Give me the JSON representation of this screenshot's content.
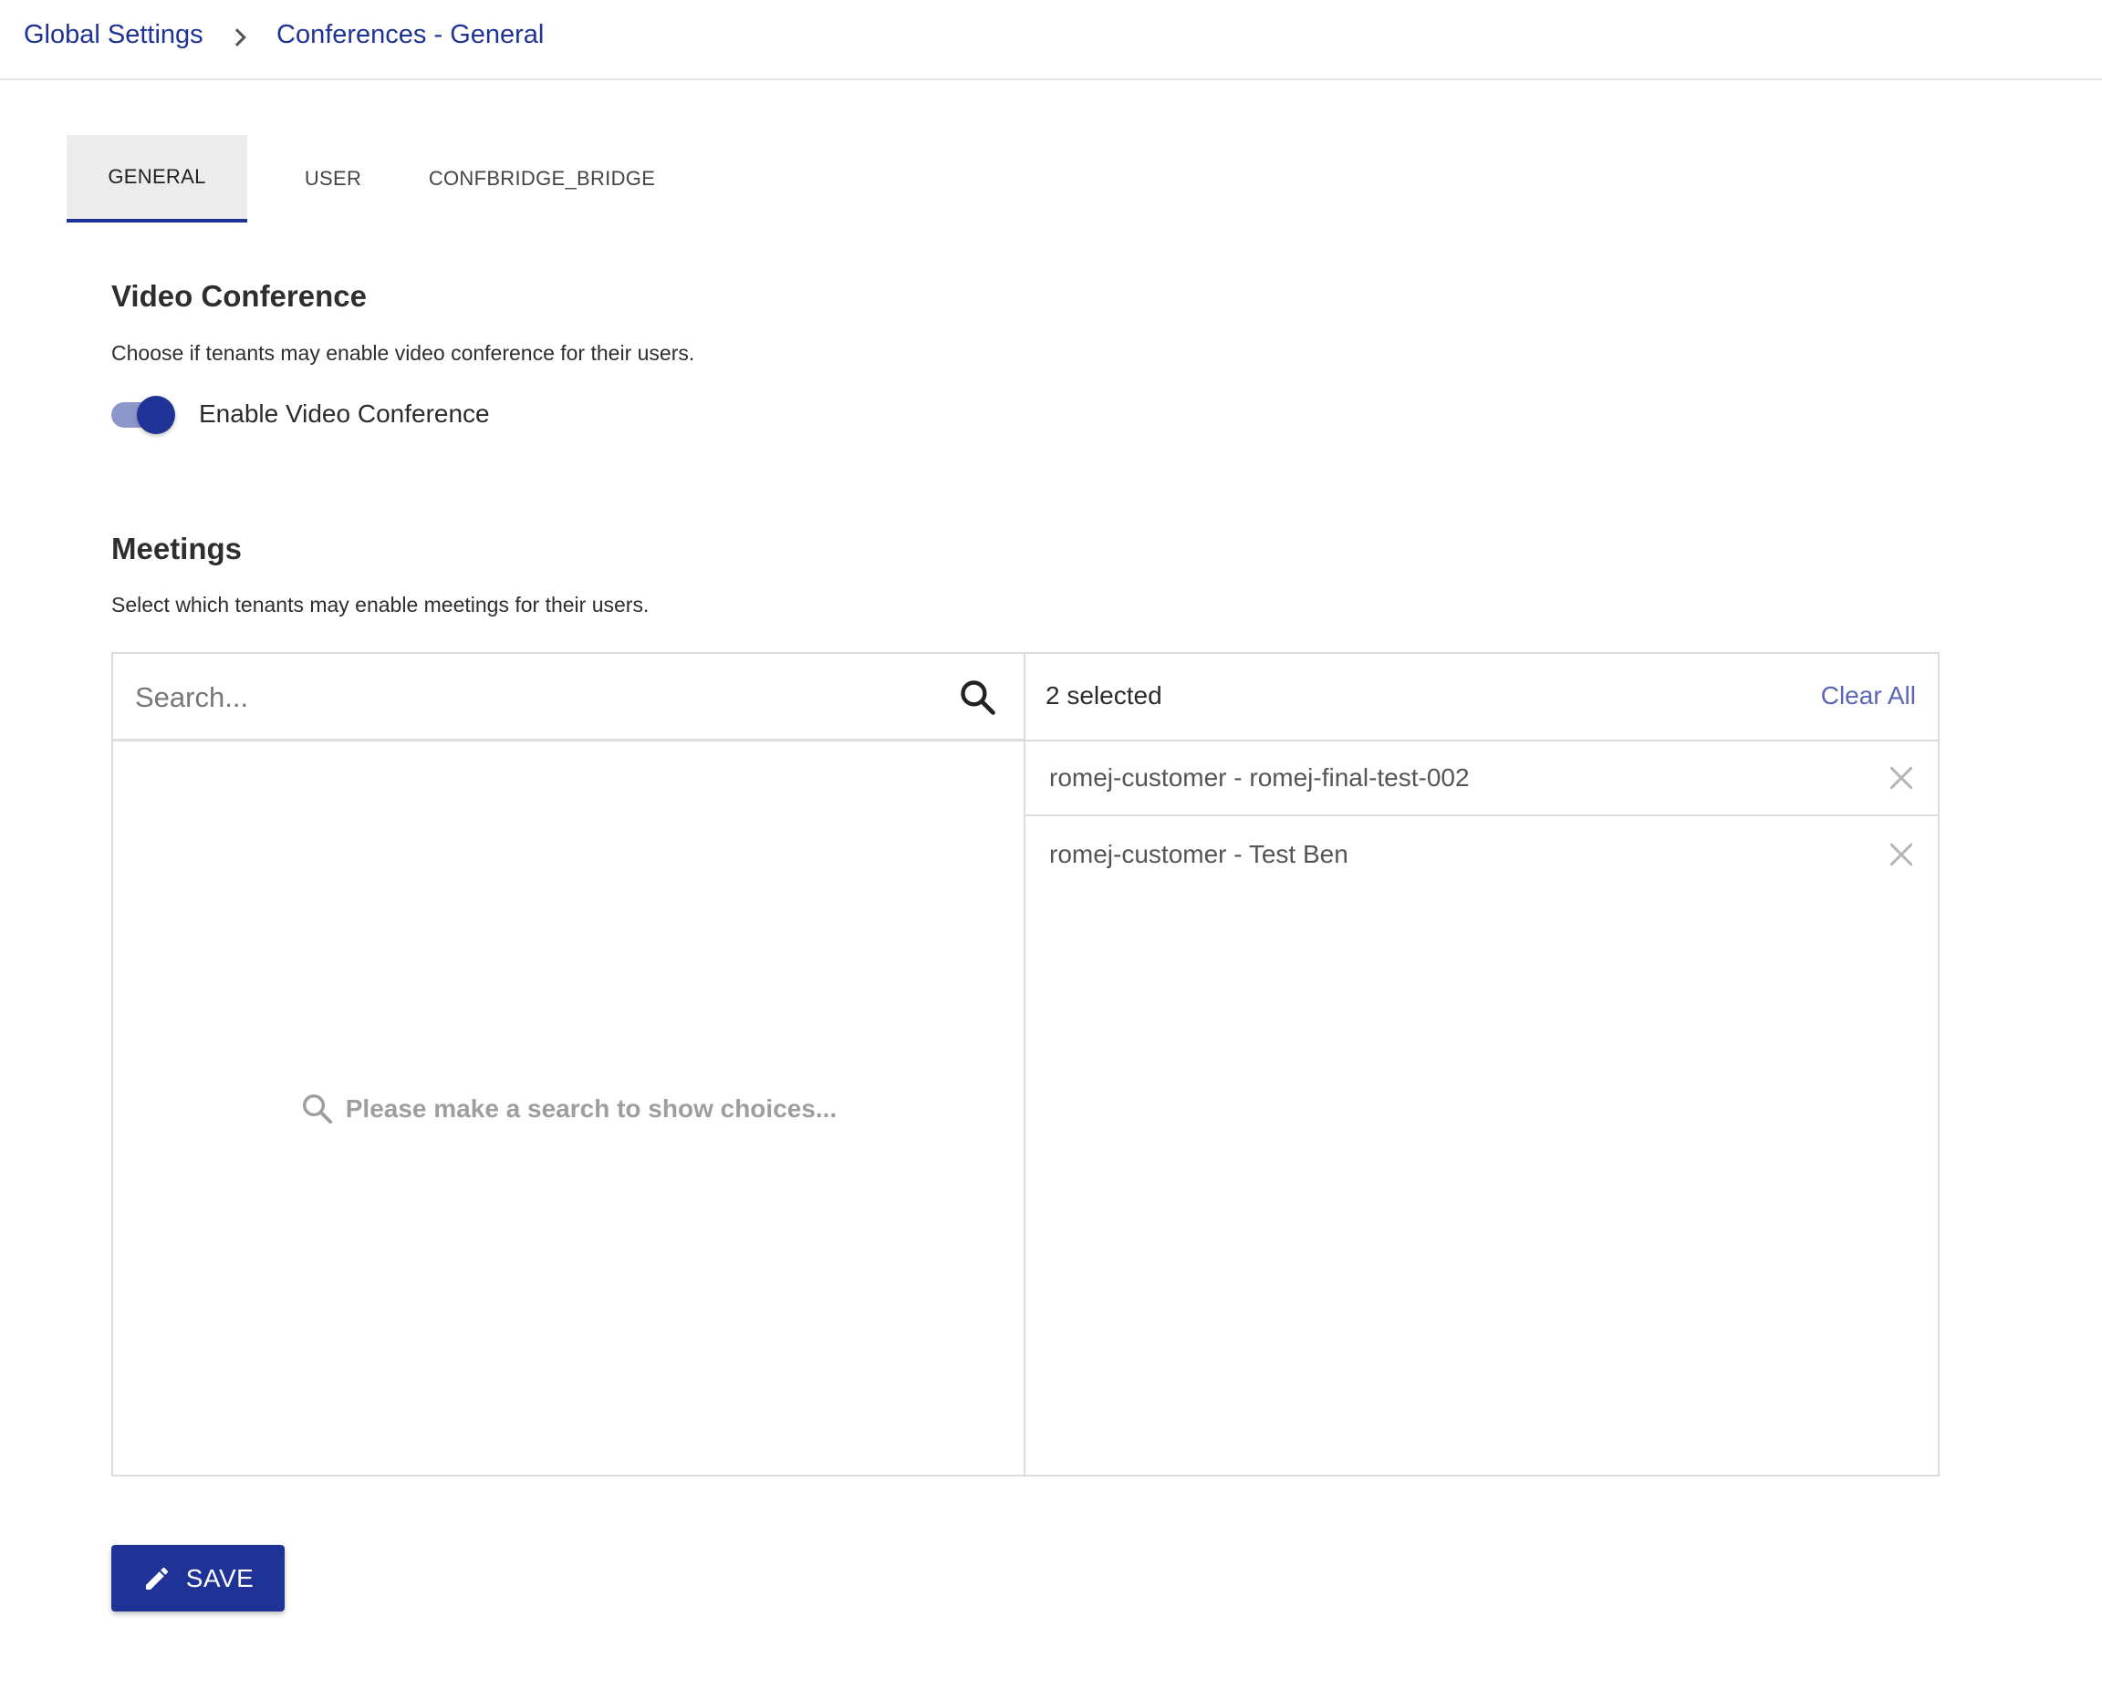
{
  "breadcrumb": {
    "items": [
      "Global Settings",
      "Conferences - General"
    ],
    "separator_icon": "chevron-right-icon"
  },
  "tabs": [
    {
      "label": "GENERAL",
      "active": true
    },
    {
      "label": "USER",
      "active": false
    },
    {
      "label": "CONFBRIDGE_BRIDGE",
      "active": false
    }
  ],
  "video_conference": {
    "title": "Video Conference",
    "description": "Choose if tenants may enable video conference for their users.",
    "toggle_label": "Enable Video Conference",
    "toggle_on": true
  },
  "meetings": {
    "title": "Meetings",
    "description": "Select which tenants may enable meetings for their users.",
    "search": {
      "placeholder": "Search...",
      "value": ""
    },
    "empty_text": "Please make a search to show choices...",
    "selected_count_label": "2 selected",
    "clear_all_label": "Clear All",
    "selected_items": [
      "romej-customer - romej-final-test-002",
      "romej-customer - Test Ben"
    ]
  },
  "save_button": {
    "label": "SAVE",
    "icon": "pencil-icon"
  },
  "colors": {
    "primary": "#1f3396",
    "toggle_track": "#8e97c9",
    "link": "#5a65b5",
    "muted_text": "#9e9e9e",
    "border": "#dcdcdc"
  }
}
